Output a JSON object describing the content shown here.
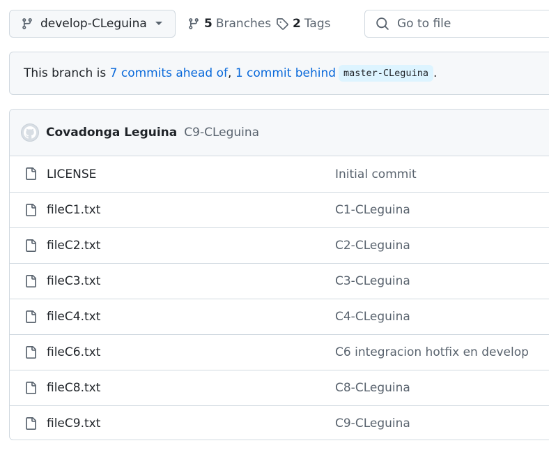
{
  "toolbar": {
    "branch_name": "develop-CLeguina",
    "branches_count": "5",
    "branches_label": "Branches",
    "tags_count": "2",
    "tags_label": "Tags",
    "goto_label": "Go to file"
  },
  "banner": {
    "prefix": "This branch is ",
    "ahead_link": "7 commits ahead of",
    "separator": ", ",
    "behind_link": "1 commit behind",
    "base_branch": "master-CLeguina",
    "suffix": "."
  },
  "latest_commit": {
    "author": "Covadonga Leguina",
    "message": "C9-CLeguina"
  },
  "files": [
    {
      "name": "LICENSE",
      "message": "Initial commit"
    },
    {
      "name": "fileC1.txt",
      "message": "C1-CLeguina"
    },
    {
      "name": "fileC2.txt",
      "message": "C2-CLeguina"
    },
    {
      "name": "fileC3.txt",
      "message": "C3-CLeguina"
    },
    {
      "name": "fileC4.txt",
      "message": "C4-CLeguina"
    },
    {
      "name": "fileC6.txt",
      "message": "C6 integracion hotfix en develop"
    },
    {
      "name": "fileC8.txt",
      "message": "C8-CLeguina"
    },
    {
      "name": "fileC9.txt",
      "message": "C9-CLeguina"
    }
  ],
  "colors": {
    "link": "#0969da",
    "muted": "#59636e",
    "border": "#d1d9e0",
    "subtle_bg": "#f6f8fa"
  },
  "icons": {
    "branch": "git-branch-icon",
    "tag": "tag-icon",
    "search": "search-icon",
    "file": "file-icon",
    "avatar": "github-avatar-icon"
  }
}
